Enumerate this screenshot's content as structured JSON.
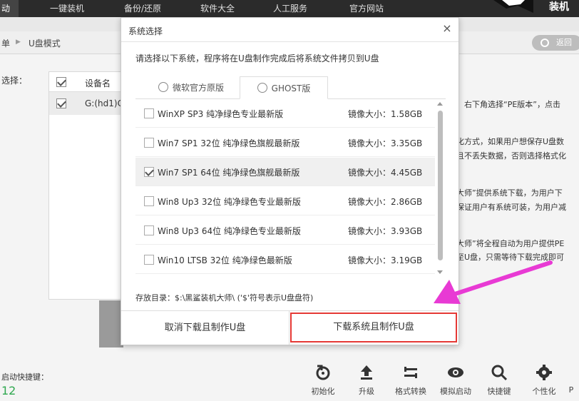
{
  "topbar": {
    "nav": [
      "动",
      "一键装机",
      "备份/还原",
      "软件大全",
      "人工服务",
      "官方网站"
    ],
    "brand": "装机"
  },
  "breadcrumb": {
    "prefix": "单",
    "sep": "▶",
    "current": "U盘模式",
    "back": "返回"
  },
  "left": {
    "select_label": "选择：",
    "table": {
      "header": "设备名",
      "row": "G:(hd1)C"
    }
  },
  "right_info": [
    "，右下角选择“PE版本”，点击",
    "化方式，如果用户想保存U盘数",
    "且不丢失数据，否则选择格式化",
    "大师”提供系统下载，为用户下",
    "保证用户有系统可装，为用户减",
    "大师”将全程自动为用户提供PE",
    "至U盘，只需等待下载完成即可"
  ],
  "bottom": {
    "hotkey_label": "启动快捷键：",
    "hotkey_value": "12",
    "tools": [
      "初始化",
      "升级",
      "格式转换",
      "模拟启动",
      "快捷键",
      "个性化",
      "P"
    ]
  },
  "dialog": {
    "title": "系统选择",
    "close": "×",
    "instruction": "请选择以下系统，程序将在U盘制作完成后将系统文件拷贝到U盘",
    "tabs": [
      "微软官方原版",
      "GHOST版"
    ],
    "items": [
      {
        "name": "WinXP SP3 纯净绿色专业最新版",
        "size": "镜像大小：1.58GB",
        "checked": false
      },
      {
        "name": "Win7 SP1 32位 纯净绿色旗舰最新版",
        "size": "镜像大小：3.35GB",
        "checked": false
      },
      {
        "name": "Win7 SP1 64位 纯净绿色旗舰最新版",
        "size": "镜像大小：4.45GB",
        "checked": true
      },
      {
        "name": "Win8 Up3 32位 纯净绿色专业最新版",
        "size": "镜像大小：2.86GB",
        "checked": false
      },
      {
        "name": "Win8 Up3 64位 纯净绿色专业最新版",
        "size": "镜像大小：3.93GB",
        "checked": false
      },
      {
        "name": "Win10 LTSB 32位 纯净绿色最新版",
        "size": "镜像大小：3.19GB",
        "checked": false
      }
    ],
    "save_dir": "存放目录：$:\\黑鲨装机大师\\ ('$'符号表示U盘盘符)",
    "cancel": "取消下载且制作U盘",
    "confirm": "下载系统且制作U盘"
  },
  "colors": {
    "accent_red": "#e53935",
    "arrow_magenta": "#e83ad4",
    "hotkey_green": "#2fa84f"
  }
}
